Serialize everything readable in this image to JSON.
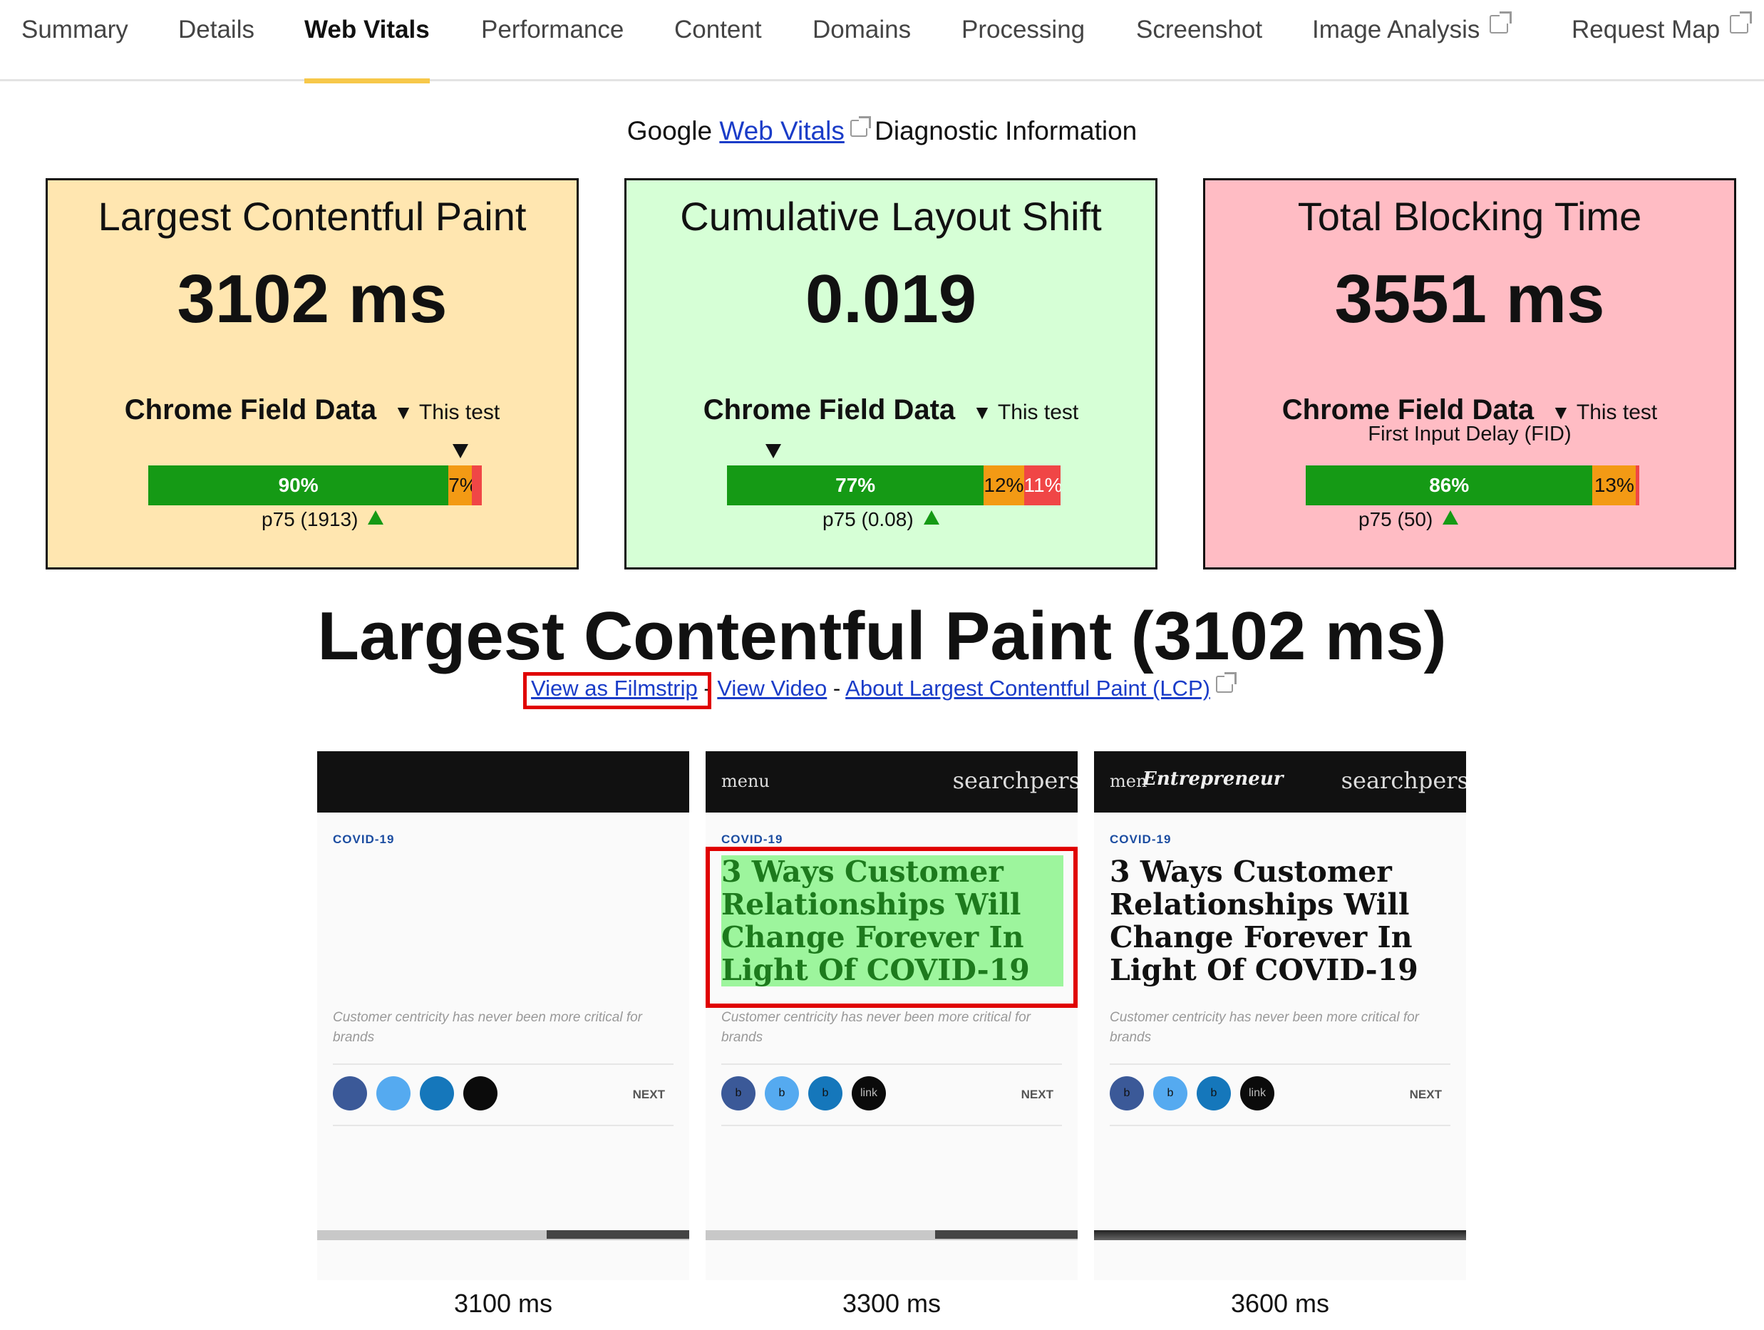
{
  "tabs": [
    {
      "label": "Summary",
      "active": false,
      "external": false
    },
    {
      "label": "Details",
      "active": false,
      "external": false
    },
    {
      "label": "Web Vitals",
      "active": true,
      "external": false
    },
    {
      "label": "Performance",
      "active": false,
      "external": false
    },
    {
      "label": "Content",
      "active": false,
      "external": false
    },
    {
      "label": "Domains",
      "active": false,
      "external": false
    },
    {
      "label": "Processing",
      "active": false,
      "external": false
    },
    {
      "label": "Screenshot",
      "active": false,
      "external": false
    },
    {
      "label": "Image Analysis",
      "active": false,
      "external": true
    },
    {
      "label": "Request Map",
      "active": false,
      "external": true
    }
  ],
  "intro": {
    "prefix": "Google",
    "link": "Web Vitals",
    "suffix": "Diagnostic Information"
  },
  "metrics": [
    {
      "title": "Largest Contentful Paint",
      "value": "3102 ms",
      "field_label": "Chrome Field Data",
      "this_test_label": "This test",
      "sub_label": "",
      "good_pct": "90%",
      "ni_pct": "7%",
      "poor_pct": "",
      "good_frac": 0.9,
      "ni_frac": 0.07,
      "poor_frac": 0.03,
      "p75": "p75 (1913)",
      "background": "#ffe6b0"
    },
    {
      "title": "Cumulative Layout Shift",
      "value": "0.019",
      "field_label": "Chrome Field Data",
      "this_test_label": "This test",
      "sub_label": "",
      "good_pct": "77%",
      "ni_pct": "12%",
      "poor_pct": "11%",
      "good_frac": 0.77,
      "ni_frac": 0.12,
      "poor_frac": 0.11,
      "p75": "p75 (0.08)",
      "background": "#d6ffd6"
    },
    {
      "title": "Total Blocking Time",
      "value": "3551 ms",
      "field_label": "Chrome Field Data",
      "this_test_label": "This test",
      "sub_label": "First Input Delay (FID)",
      "good_pct": "86%",
      "ni_pct": "13%",
      "poor_pct": "",
      "good_frac": 0.86,
      "ni_frac": 0.13,
      "poor_frac": 0.01,
      "p75": "p75 (50)",
      "background": "#ffbcc4"
    }
  ],
  "section": {
    "title": "Largest Contentful Paint (3102 ms)",
    "links": {
      "filmstrip": "View as Filmstrip",
      "sep": "-",
      "video": "View Video",
      "about": "About Largest Contentful Paint (LCP)"
    }
  },
  "filmstrip": [
    {
      "time": "3100 ms",
      "menu": "",
      "search": "",
      "brand": "",
      "category": "COVID-19",
      "headline": "",
      "description": "Customer centricity has never been more critical for brands",
      "dots": [
        "",
        "",
        "",
        ""
      ],
      "next": "NEXT"
    },
    {
      "time": "3300 ms",
      "menu": "menu",
      "search": "searchpers",
      "brand": "",
      "category": "COVID-19",
      "headline": "3 Ways Customer Relationships Will Change Forever In Light Of COVID-19",
      "description": "Customer centricity has never been more critical for brands",
      "dots": [
        "b",
        "b",
        "b",
        "link"
      ],
      "next": "NEXT"
    },
    {
      "time": "3600 ms",
      "menu": "men",
      "search": "searchpers",
      "brand": "Entrepreneur",
      "category": "COVID-19",
      "headline": "3 Ways Customer Relationships Will Change Forever In Light Of COVID-19",
      "description": "Customer centricity has never been more critical for brands",
      "dots": [
        "b",
        "b",
        "b",
        "link"
      ],
      "next": "NEXT"
    }
  ],
  "colors": {
    "good": "#159a15",
    "needs_improvement": "#f39a14",
    "poor": "#f04646",
    "active_tab_underline": "#f7c84a",
    "highlight_box": "#e00000",
    "lcp_element_highlight": "#9df59d"
  }
}
